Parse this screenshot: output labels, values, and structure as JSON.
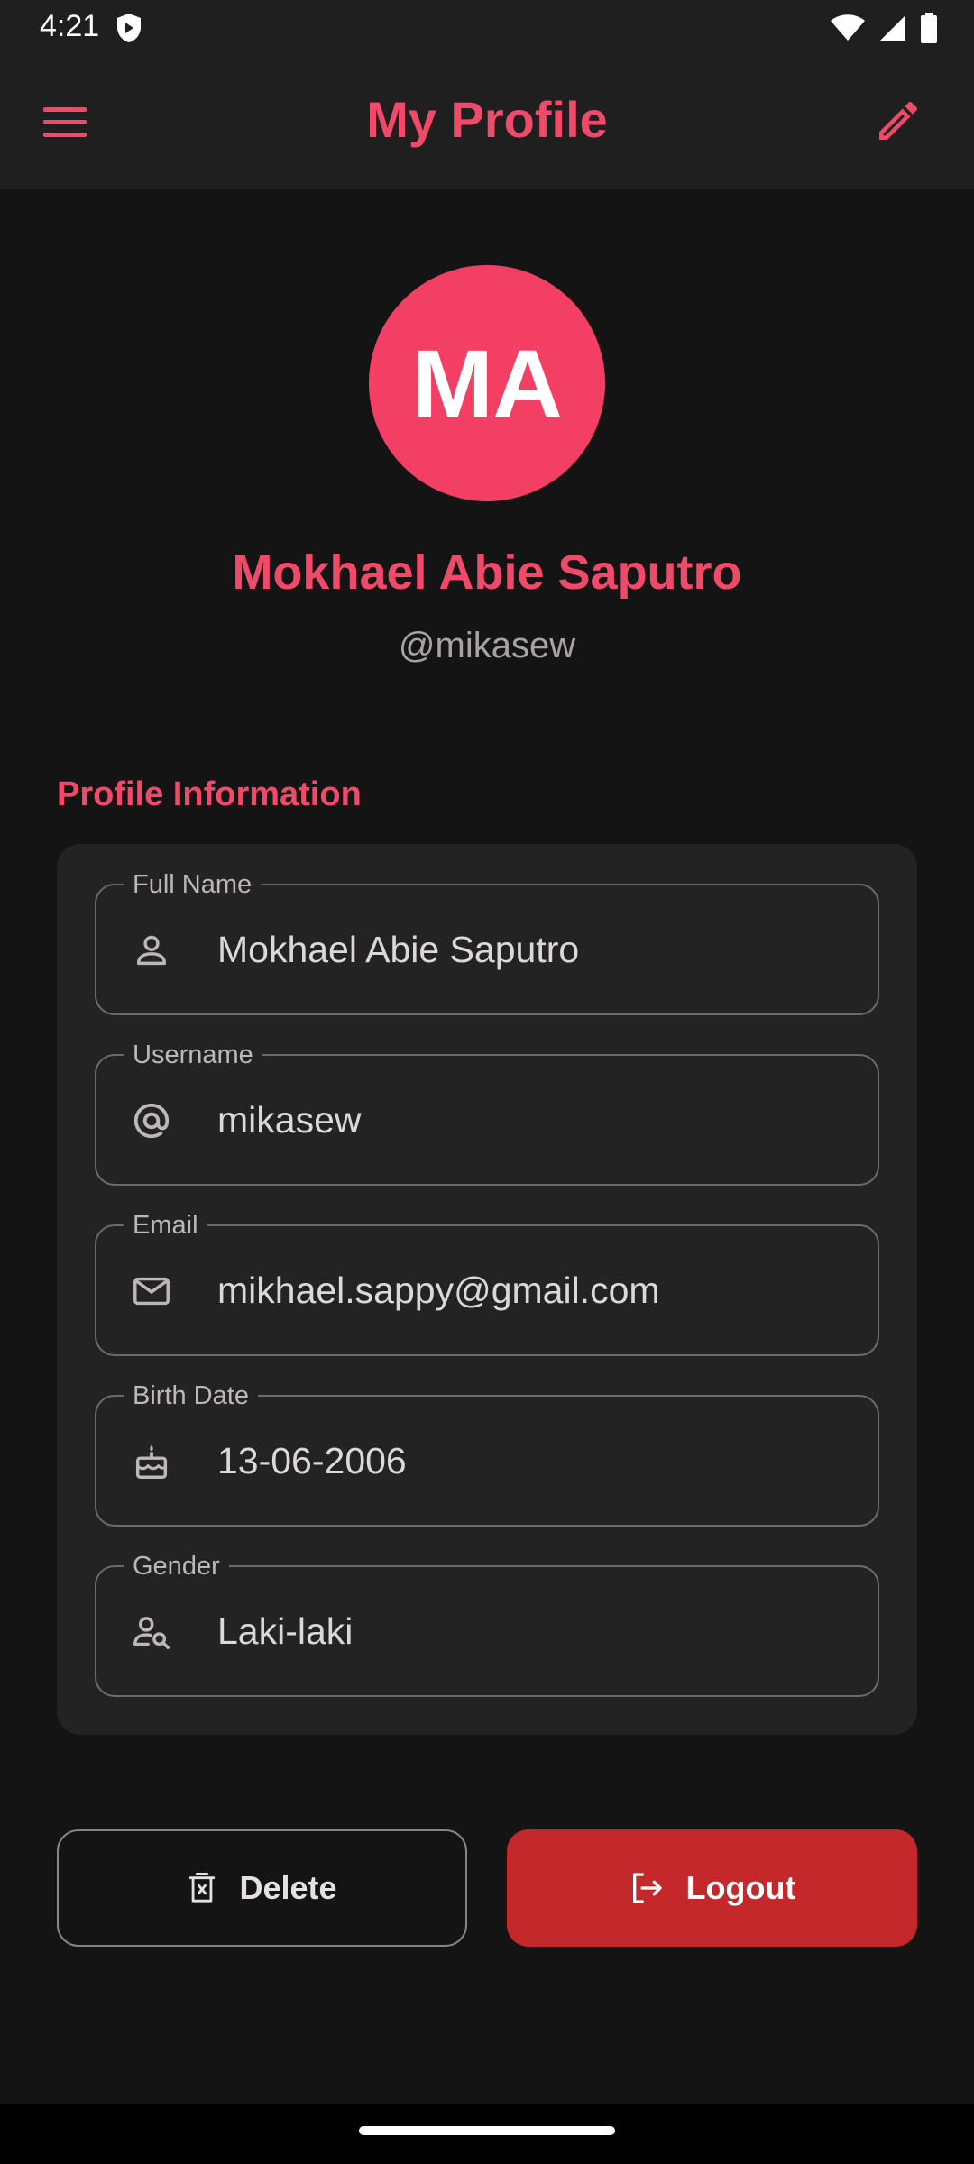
{
  "status_bar": {
    "time": "4:21"
  },
  "app_bar": {
    "title": "My Profile",
    "icons": {
      "menu": "menu-icon",
      "edit": "edit-pencil-icon"
    }
  },
  "profile": {
    "initials": "MA",
    "name": "Mokhael Abie Saputro",
    "handle": "@mikasew"
  },
  "section": {
    "title": "Profile Information"
  },
  "fields": [
    {
      "label": "Full Name",
      "value": "Mokhael Abie Saputro",
      "icon": "person-icon"
    },
    {
      "label": "Username",
      "value": "mikasew",
      "icon": "at-sign-icon"
    },
    {
      "label": "Email",
      "value": "mikhael.sappy@gmail.com",
      "icon": "mail-icon"
    },
    {
      "label": "Birth Date",
      "value": "13-06-2006",
      "icon": "cake-icon"
    },
    {
      "label": "Gender",
      "value": "Laki-laki",
      "icon": "person-search-icon"
    }
  ],
  "actions": {
    "delete_label": "Delete",
    "logout_label": "Logout"
  },
  "colors": {
    "accent": "#f04a6a",
    "avatar_bg": "#f43f64",
    "logout_bg": "#c5282b",
    "background": "#141414",
    "card": "#232323"
  }
}
